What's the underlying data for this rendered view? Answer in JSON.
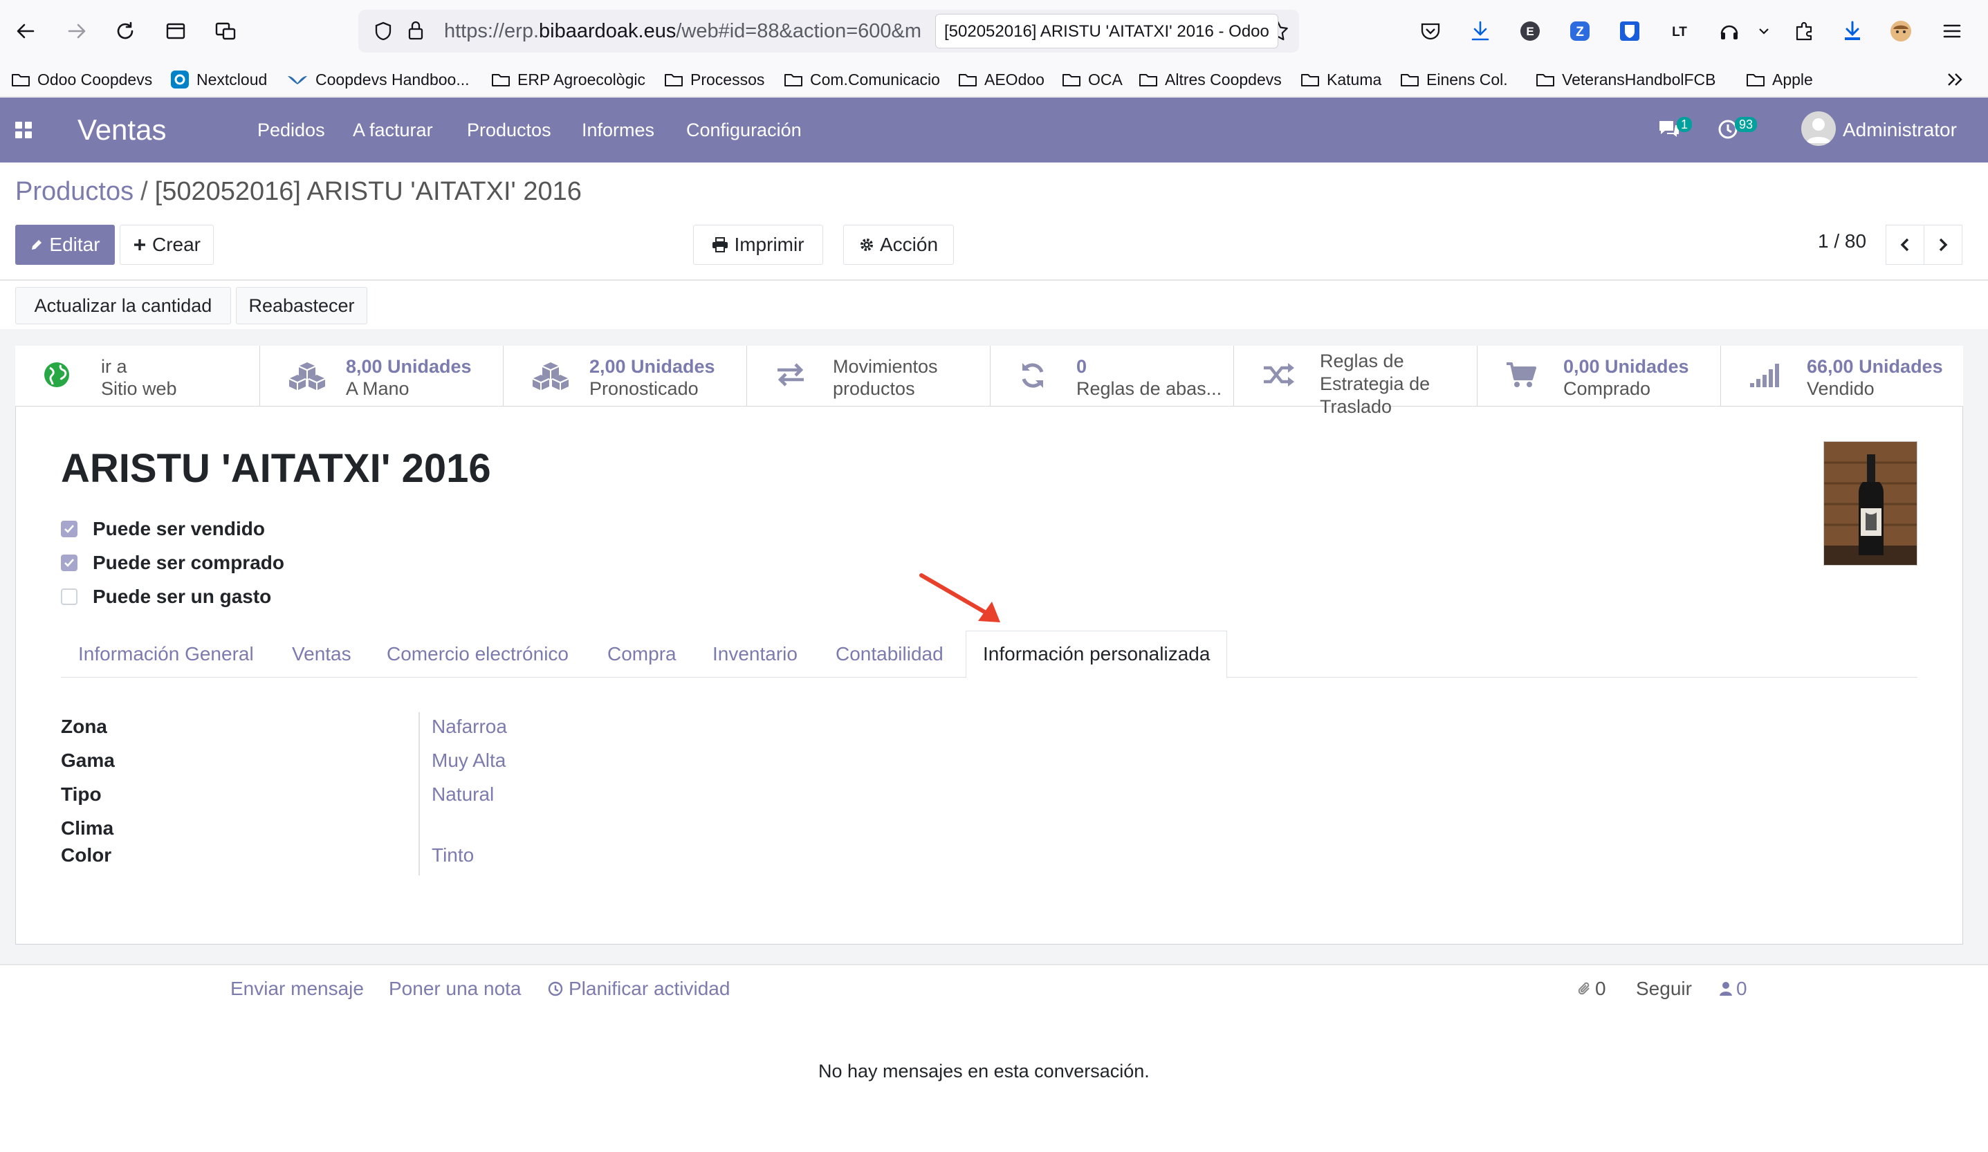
{
  "browser": {
    "url_prefix": "https://erp.",
    "url_domain": "bibaardoak.eus",
    "url_suffix": "/web#id=88&action=600&m",
    "tab_tooltip": "[502052016] ARISTU 'AITATXI' 2016 - Odoo"
  },
  "bookmarks": [
    {
      "label": "Odoo Coopdevs",
      "icon": "folder-icon"
    },
    {
      "label": "Nextcloud",
      "icon": "nextcloud-icon"
    },
    {
      "label": "Coopdevs Handboo...",
      "icon": "bird-icon"
    },
    {
      "label": "ERP Agroecològic",
      "icon": "folder-icon"
    },
    {
      "label": "Processos",
      "icon": "folder-icon"
    },
    {
      "label": "Com.Comunicacio",
      "icon": "folder-icon"
    },
    {
      "label": "AEOdoo",
      "icon": "folder-icon"
    },
    {
      "label": "OCA",
      "icon": "folder-icon"
    },
    {
      "label": "Altres Coopdevs",
      "icon": "folder-icon"
    },
    {
      "label": "Katuma",
      "icon": "folder-icon"
    },
    {
      "label": "Einens Col.",
      "icon": "folder-icon"
    },
    {
      "label": "VeteransHandbolFCB",
      "icon": "folder-icon"
    },
    {
      "label": "Apple",
      "icon": "folder-icon"
    }
  ],
  "navbar": {
    "app_name": "Ventas",
    "menu": [
      "Pedidos",
      "A facturar",
      "Productos",
      "Informes",
      "Configuración"
    ],
    "messages_badge": "1",
    "activities_badge": "93",
    "user": "Administrator"
  },
  "breadcrumb": {
    "parent": "Productos",
    "separator": "/",
    "current": "[502052016] ARISTU 'AITATXI' 2016"
  },
  "actions": {
    "edit": "Editar",
    "create": "Crear",
    "print": "Imprimir",
    "action": "Acción",
    "pager": "1 / 80"
  },
  "header_buttons": {
    "update_qty": "Actualizar la cantidad",
    "replenish": "Reabastecer"
  },
  "smart_buttons": [
    {
      "line1": "ir a",
      "line2": "Sitio web",
      "icon": "globe-icon"
    },
    {
      "line1": "8,00 Unidades",
      "line2": "A Mano",
      "icon": "cubes-icon"
    },
    {
      "line1": "2,00 Unidades",
      "line2": "Pronosticado",
      "icon": "cubes-icon"
    },
    {
      "line1": "Movimientos",
      "line2": "productos",
      "icon": "exchange-icon"
    },
    {
      "line1": "0",
      "line2": "Reglas de abas...",
      "icon": "refresh-icon"
    },
    {
      "line1": "Reglas de",
      "line2": "Estrategia de",
      "line3": "Traslado",
      "icon": "random-icon"
    },
    {
      "line1": "0,00 Unidades",
      "line2": "Comprado",
      "icon": "cart-icon"
    },
    {
      "line1": "66,00 Unidades",
      "line2": "Vendido",
      "icon": "bar-chart-icon"
    }
  ],
  "product": {
    "name": "ARISTU 'AITATXI' 2016",
    "checkboxes": [
      {
        "label": "Puede ser vendido",
        "checked": true
      },
      {
        "label": "Puede ser comprado",
        "checked": true
      },
      {
        "label": "Puede ser un gasto",
        "checked": false
      }
    ]
  },
  "tabs": [
    "Información General",
    "Ventas",
    "Comercio electrónico",
    "Compra",
    "Inventario",
    "Contabilidad",
    "Información personalizada"
  ],
  "active_tab": "Información personalizada",
  "fields": [
    {
      "label": "Zona",
      "value": "Nafarroa"
    },
    {
      "label": "Gama",
      "value": "Muy Alta"
    },
    {
      "label": "Tipo",
      "value": "Natural"
    },
    {
      "label": "Clima",
      "value": ""
    },
    {
      "label": "Color",
      "value": "Tinto"
    }
  ],
  "chatter": {
    "send_message": "Enviar mensaje",
    "log_note": "Poner una nota",
    "schedule_activity": "Planificar actividad",
    "attachments": "0",
    "follow": "Seguir",
    "followers": "0",
    "empty": "No hay mensajes en esta conversación."
  },
  "colors": {
    "brand": "#7c7bad",
    "annotation_arrow": "#e8402a"
  }
}
